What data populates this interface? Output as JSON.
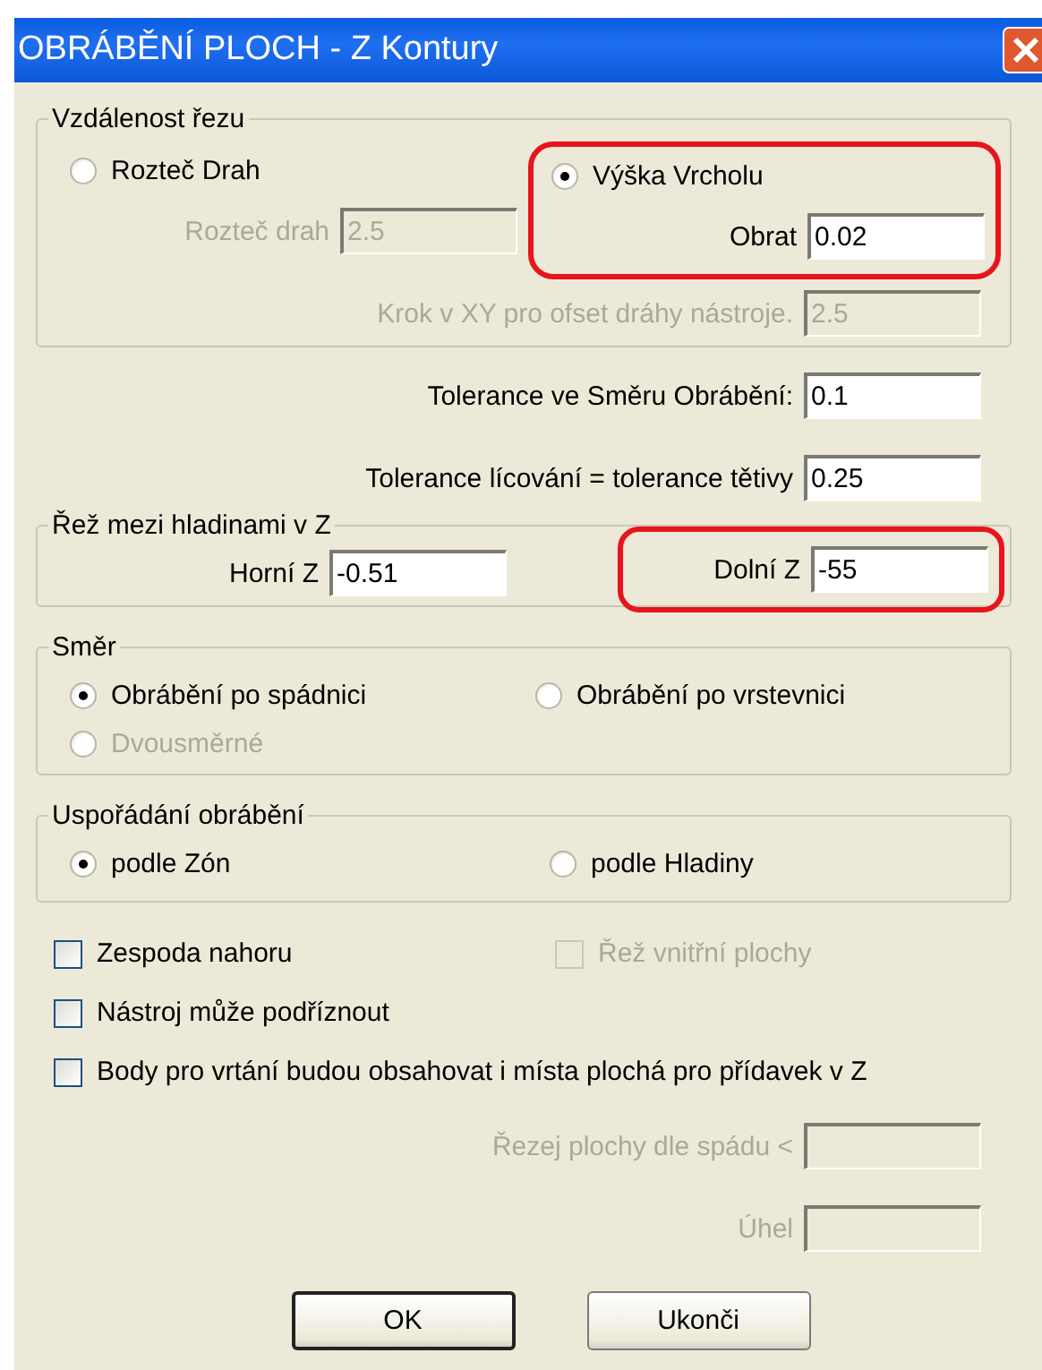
{
  "window": {
    "title": "OBRÁBĚNÍ PLOCH - Z Kontury"
  },
  "cut_distance": {
    "title": "Vzdálenost řezu",
    "options": [
      {
        "label": "Rozteč Drah",
        "selected": false,
        "disabled": false,
        "highlighted": false
      },
      {
        "label": "Výška Vrcholu",
        "selected": true,
        "disabled": false,
        "highlighted": true
      }
    ],
    "fields": [
      {
        "label": "Rozteč drah",
        "value": "2.5",
        "disabled": true
      },
      {
        "label": "Obrat",
        "value": "0.02",
        "disabled": false
      },
      {
        "label": "Krok v XY pro ofset dráhy nástroje.",
        "value": "2.5",
        "disabled": true
      }
    ]
  },
  "tolerances": [
    {
      "label": "Tolerance ve Směru Obrábění:",
      "value": "0.1"
    },
    {
      "label": "Tolerance lícování = tolerance tětivy",
      "value": "0.25"
    }
  ],
  "z_range": {
    "title": "Řež mezi hladinami v Z",
    "fields": [
      {
        "label": "Horní Z",
        "value": "-0.51",
        "highlighted": false
      },
      {
        "label": "Dolní Z",
        "value": "-55",
        "highlighted": true
      }
    ]
  },
  "direction": {
    "title": "Směr",
    "options": [
      {
        "label": "Obrábění po spádnici",
        "selected": true,
        "disabled": false
      },
      {
        "label": "Obrábění po vrstevnici",
        "selected": false,
        "disabled": false
      },
      {
        "label": "Dvousměrné",
        "selected": false,
        "disabled": true
      }
    ]
  },
  "ordering": {
    "title": "Uspořádání obrábění",
    "options": [
      {
        "label": "podle Zón",
        "selected": true,
        "disabled": false
      },
      {
        "label": "podle Hladiny",
        "selected": false,
        "disabled": false
      }
    ]
  },
  "checkboxes": [
    {
      "label": "Zespoda nahoru",
      "checked": false,
      "disabled": false
    },
    {
      "label": "Řež vnitřní plochy",
      "checked": false,
      "disabled": true
    },
    {
      "label": "Nástroj může podříznout",
      "checked": false,
      "disabled": false
    },
    {
      "label": "Body pro vrtání budou obsahovat i místa plochá pro přídavek v Z",
      "checked": false,
      "disabled": false
    }
  ],
  "extra_fields": [
    {
      "label": "Řezej plochy dle spádu <",
      "disabled": true
    },
    {
      "label": "Úhel",
      "disabled": true
    }
  ],
  "buttons": [
    {
      "label": "OK",
      "default": true
    },
    {
      "label": "Ukonči",
      "default": false
    }
  ]
}
